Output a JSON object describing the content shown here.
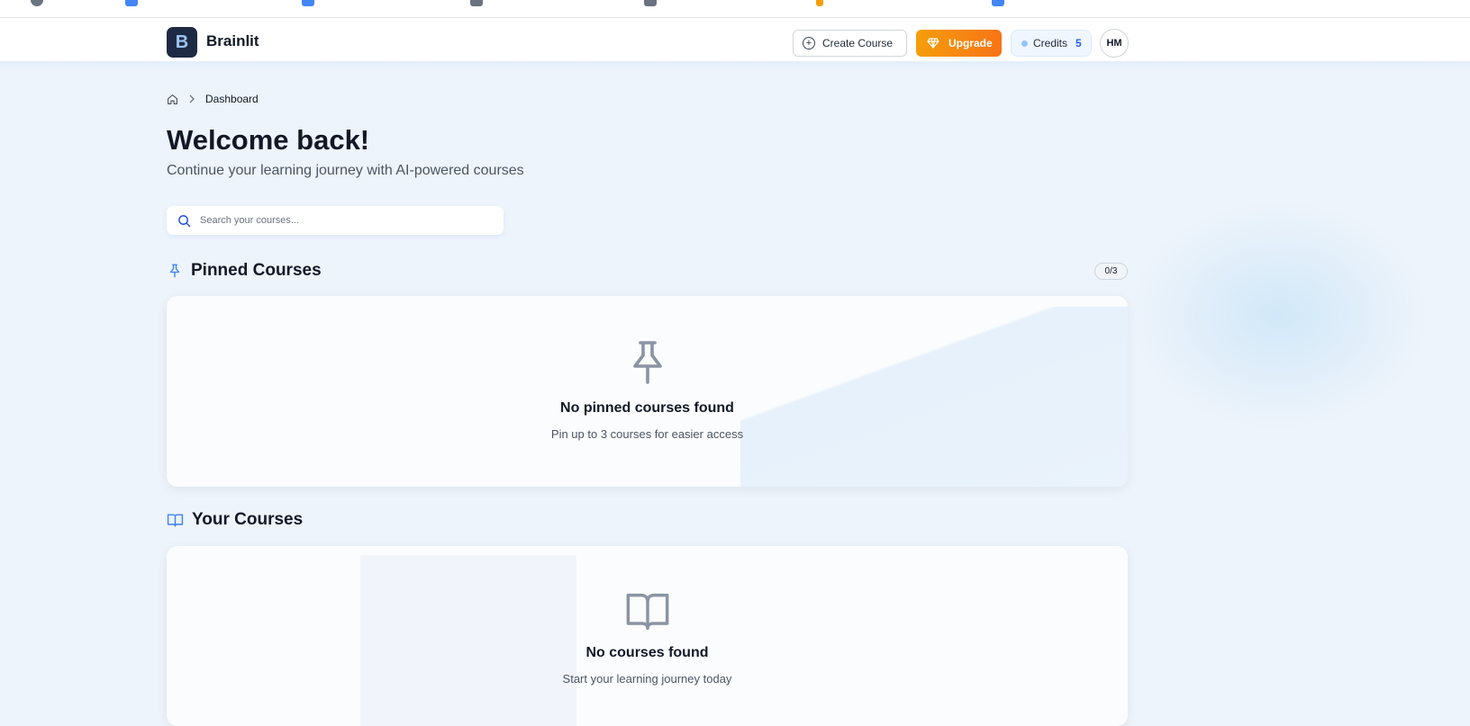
{
  "app": {
    "name": "Brainlit",
    "logo_letter": "B"
  },
  "header": {
    "create_label": "Create Course",
    "upgrade_label": "Upgrade",
    "credits_label": "Credits",
    "credits_value": "5",
    "avatar_initials": "HM"
  },
  "breadcrumb": {
    "current": "Dashboard"
  },
  "page": {
    "title": "Welcome back!",
    "subtitle": "Continue your learning journey with AI-powered courses"
  },
  "search": {
    "placeholder": "Search your courses..."
  },
  "pinned": {
    "heading": "Pinned Courses",
    "count_badge": "0/3",
    "empty_title": "No pinned courses found",
    "empty_desc": "Pin up to 3 courses for easier access"
  },
  "courses": {
    "heading": "Your Courses",
    "empty_title": "No courses found",
    "empty_desc": "Start your learning journey today"
  },
  "colors": {
    "accent": "#3b82f6",
    "upgrade": "#f59e0b",
    "background": "#eef4fb"
  },
  "icons": [
    "home-icon",
    "chevron-right-icon",
    "plus-circle-icon",
    "diamond-icon",
    "search-icon",
    "pin-icon",
    "book-open-icon"
  ]
}
